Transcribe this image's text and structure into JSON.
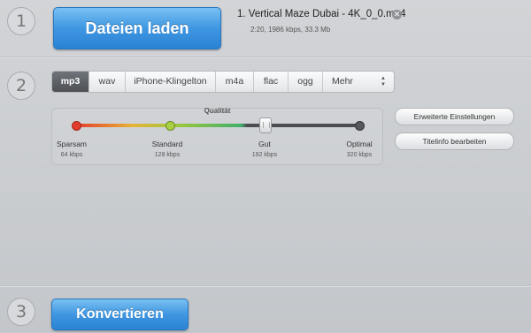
{
  "steps": [
    "1",
    "2",
    "3"
  ],
  "load_button": {
    "label": "Dateien laden"
  },
  "file": {
    "title": "1. Vertical Maze Dubai - 4K_0_0.mp4",
    "info": "2:20, 1986 kbps, 33.3 Mb",
    "remove_icon": "close-circle-icon"
  },
  "formats": {
    "tabs": [
      "mp3",
      "wav",
      "iPhone-Klingelton",
      "m4a",
      "flac",
      "ogg",
      "Mehr"
    ],
    "selected": "mp3"
  },
  "quality": {
    "label": "Qualität",
    "levels": [
      {
        "name": "Sparsam",
        "bitrate": "64 kbps"
      },
      {
        "name": "Standard",
        "bitrate": "128 kbps"
      },
      {
        "name": "Gut",
        "bitrate": "192 kbps"
      },
      {
        "name": "Optimal",
        "bitrate": "320 kbps"
      }
    ],
    "selected_level": "Gut",
    "slider_fraction": 0.667
  },
  "settings_buttons": {
    "advanced": "Erweiterte Einstellungen",
    "titleinfo": "Titelinfo bearbeiten"
  },
  "convert_button": {
    "label": "Konvertieren"
  },
  "colors": {
    "accent_blue": "#3f97e2",
    "tab_active": "#5a5e63",
    "track_red": "#e33a2a",
    "track_green": "#3fb06a",
    "track_dark": "#4a4d52"
  }
}
